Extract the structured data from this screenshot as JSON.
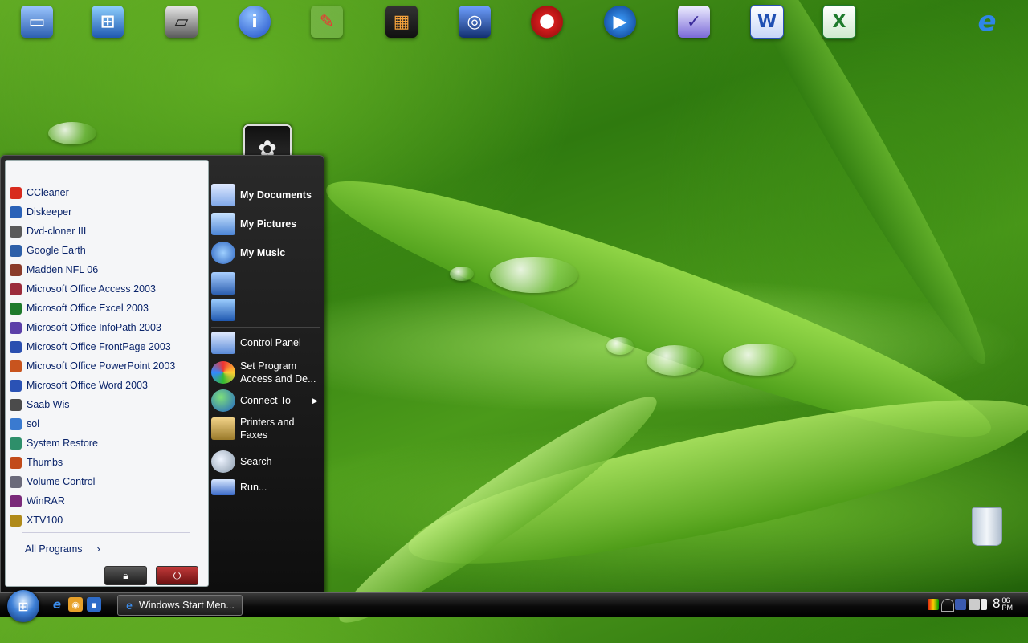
{
  "colors": {
    "accent": "#0a246a",
    "menu_dark": "#1a1a1a",
    "power_red": "#a11f1f",
    "wallpaper_green": "#4b9a1a"
  },
  "desktop_icons": [
    {
      "name": "my-computer-icon"
    },
    {
      "name": "network-places-icon"
    },
    {
      "name": "scanner-icon"
    },
    {
      "name": "info-icon"
    },
    {
      "name": "paint-brushes-icon"
    },
    {
      "name": "film-strip-icon"
    },
    {
      "name": "media-app-icon"
    },
    {
      "name": "nero-icon"
    },
    {
      "name": "media-player-icon"
    },
    {
      "name": "infopath-icon"
    },
    {
      "name": "word-icon"
    },
    {
      "name": "excel-icon"
    },
    {
      "name": "internet-explorer-icon"
    }
  ],
  "start_menu": {
    "programs": [
      {
        "label": "CCleaner",
        "icon": "ccleaner-icon",
        "color": "#d82b1e"
      },
      {
        "label": "Diskeeper",
        "icon": "diskeeper-icon",
        "color": "#2a62b8"
      },
      {
        "label": "Dvd-cloner III",
        "icon": "dvd-cloner-icon",
        "color": "#5a5a5a"
      },
      {
        "label": "Google Earth",
        "icon": "google-earth-icon",
        "color": "#2d5fa8"
      },
      {
        "label": "Madden NFL 06",
        "icon": "madden-icon",
        "color": "#8a3b2a"
      },
      {
        "label": "Microsoft Office Access 2003",
        "icon": "access-icon",
        "color": "#9b2b3b"
      },
      {
        "label": "Microsoft Office Excel 2003",
        "icon": "excel-icon",
        "color": "#1e7a2c"
      },
      {
        "label": "Microsoft Office InfoPath 2003",
        "icon": "infopath-icon",
        "color": "#5b3fa8"
      },
      {
        "label": "Microsoft Office FrontPage 2003",
        "icon": "frontpage-icon",
        "color": "#2a4fb0"
      },
      {
        "label": "Microsoft Office PowerPoint 2003",
        "icon": "powerpoint-icon",
        "color": "#c8541e"
      },
      {
        "label": "Microsoft Office Word 2003",
        "icon": "word-icon",
        "color": "#2a52b5"
      },
      {
        "label": "Saab Wis",
        "icon": "saab-wis-icon",
        "color": "#4b4b4b"
      },
      {
        "label": "sol",
        "icon": "sol-icon",
        "color": "#3a7ad0"
      },
      {
        "label": "System Restore",
        "icon": "system-restore-icon",
        "color": "#2e8f6a"
      },
      {
        "label": "Thumbs",
        "icon": "thumbs-icon",
        "color": "#c24b1a"
      },
      {
        "label": "Volume Control",
        "icon": "volume-control-icon",
        "color": "#6a6a7a"
      },
      {
        "label": "WinRAR",
        "icon": "winrar-icon",
        "color": "#7a2a7a"
      },
      {
        "label": "XTV100",
        "icon": "xtv100-icon",
        "color": "#b08a1a"
      }
    ],
    "all_programs_label": "All Programs",
    "right_items": {
      "my_documents": "My Documents",
      "my_pictures": "My Pictures",
      "my_music": "My Music",
      "control_panel": "Control Panel",
      "set_program_access_1": "Set Program",
      "set_program_access_2": "Access and De...",
      "connect_to": "Connect To",
      "printers_1": "Printers and",
      "printers_2": "Faxes",
      "search": "Search",
      "run": "Run..."
    }
  },
  "taskbar": {
    "active_window_label": "Windows Start Men...",
    "clock": {
      "hour": "8",
      "minutes": "06",
      "ampm": "PM"
    }
  }
}
